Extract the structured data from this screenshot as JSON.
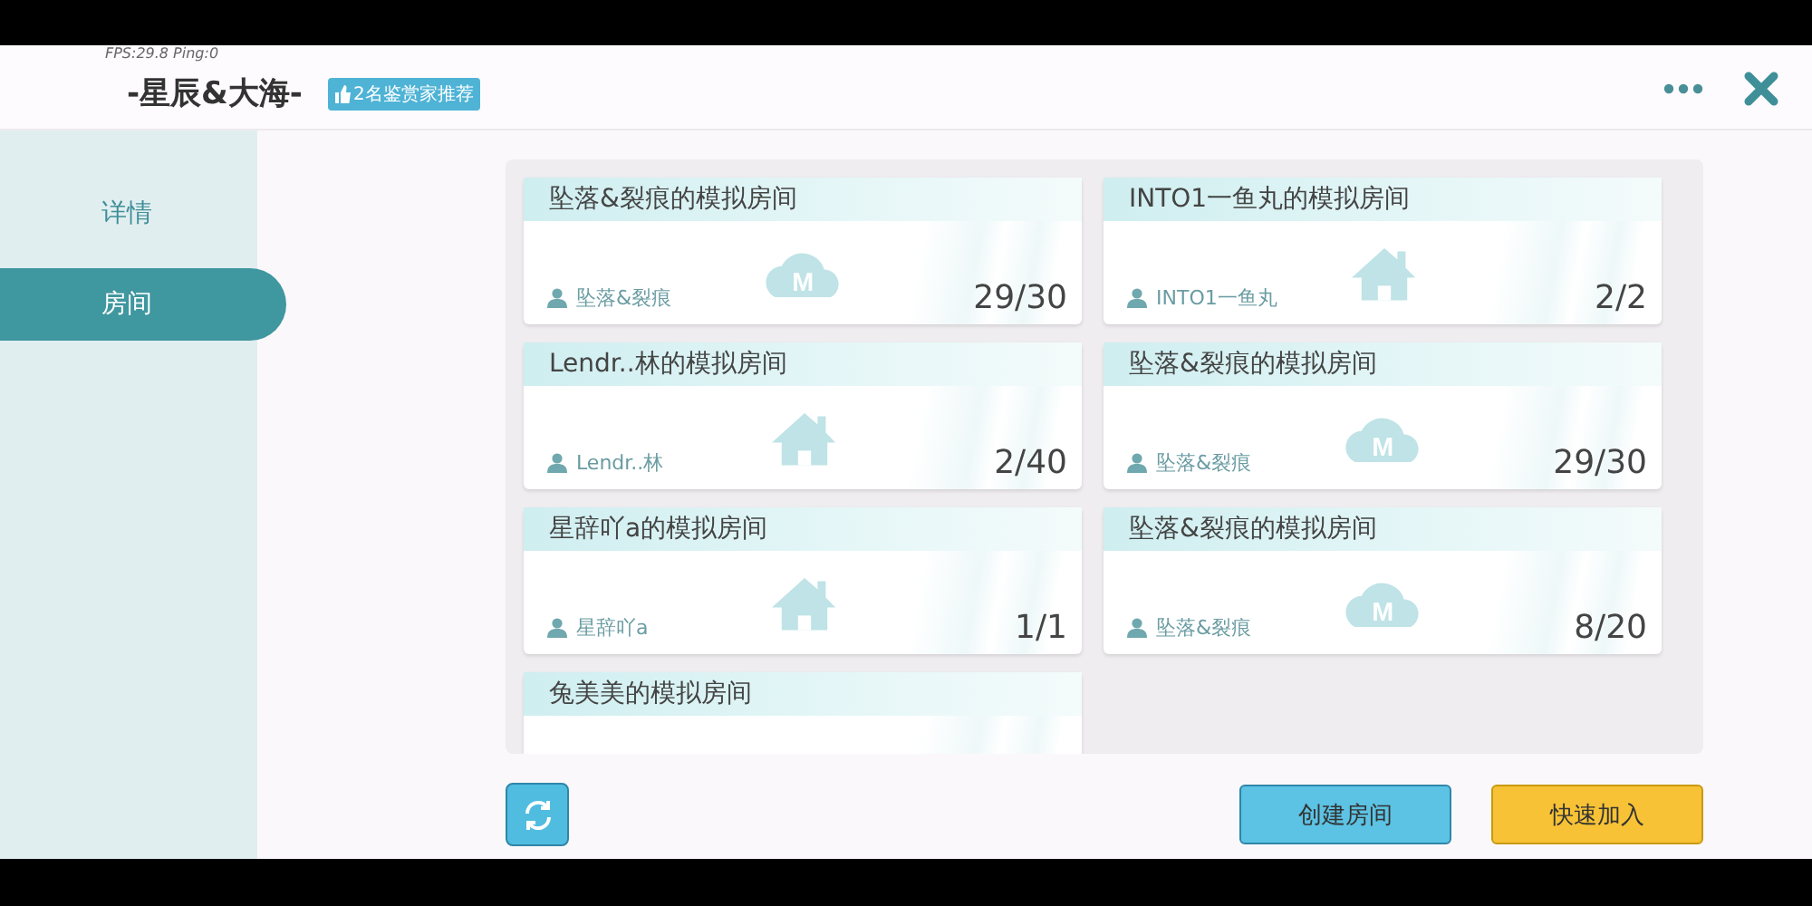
{
  "debug": "FPS:29.8  Ping:0",
  "header": {
    "title": "-星辰&大海-",
    "badge": "2名鉴赏家推荐"
  },
  "sidebar": {
    "items": [
      {
        "label": "详情",
        "selected": false
      },
      {
        "label": "房间",
        "selected": true
      }
    ]
  },
  "rooms": [
    {
      "title": "坠落&裂痕的模拟房间",
      "owner": "坠落&裂痕",
      "count": "29/30",
      "kind": "cloud",
      "icon_text": "M"
    },
    {
      "title": "INTO1一鱼丸的模拟房间",
      "owner": "INTO1一鱼丸",
      "count": "2/2",
      "kind": "house"
    },
    {
      "title": "Lendr..林的模拟房间",
      "owner": "Lendr..林",
      "count": "2/40",
      "kind": "house"
    },
    {
      "title": "坠落&裂痕的模拟房间",
      "owner": "坠落&裂痕",
      "count": "29/30",
      "kind": "cloud",
      "icon_text": "M"
    },
    {
      "title": "星辞吖a的模拟房间",
      "owner": "星辞吖a",
      "count": "1/1",
      "kind": "house"
    },
    {
      "title": "坠落&裂痕的模拟房间",
      "owner": "坠落&裂痕",
      "count": "8/20",
      "kind": "cloud",
      "icon_text": "M"
    },
    {
      "title": "兔美美的模拟房间"
    }
  ],
  "buttons": [
    {
      "label": "创建房间",
      "kind": "create"
    },
    {
      "label": "快速加入",
      "kind": "join"
    }
  ]
}
